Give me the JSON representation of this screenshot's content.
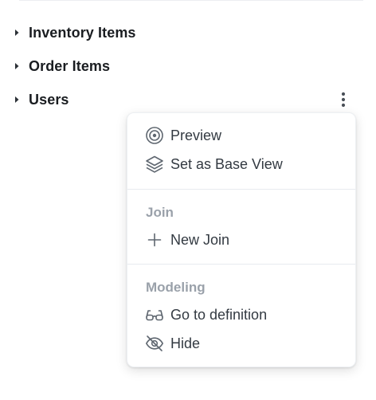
{
  "tree": {
    "items": [
      {
        "label": "Inventory Items"
      },
      {
        "label": "Order Items"
      },
      {
        "label": "Users"
      }
    ]
  },
  "menu": {
    "items": [
      {
        "label": "Preview",
        "icon": "preview-target-icon"
      },
      {
        "label": "Set as Base View",
        "icon": "layers-icon"
      }
    ],
    "sections": [
      {
        "header": "Join",
        "items": [
          {
            "label": "New Join",
            "icon": "plus-icon"
          }
        ]
      },
      {
        "header": "Modeling",
        "items": [
          {
            "label": "Go to definition",
            "icon": "glasses-icon"
          },
          {
            "label": "Hide",
            "icon": "eye-off-icon"
          }
        ]
      }
    ]
  },
  "colors": {
    "icon": "#5f6770",
    "section_header": "#9aa1aa",
    "tree_label": "#1a1d21",
    "menu_text": "#333a42"
  }
}
